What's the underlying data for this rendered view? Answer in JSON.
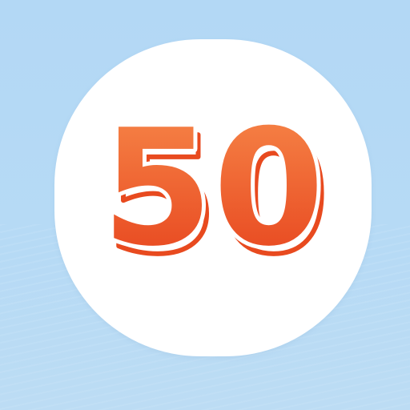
{
  "app_icon": {
    "number_text": "50",
    "colors": {
      "background": "#b4d8f5",
      "card": "#ffffff",
      "number_top": "#f47a3a",
      "number_bottom": "#e8411c",
      "shadow_stroke": "#e84a1f"
    }
  }
}
